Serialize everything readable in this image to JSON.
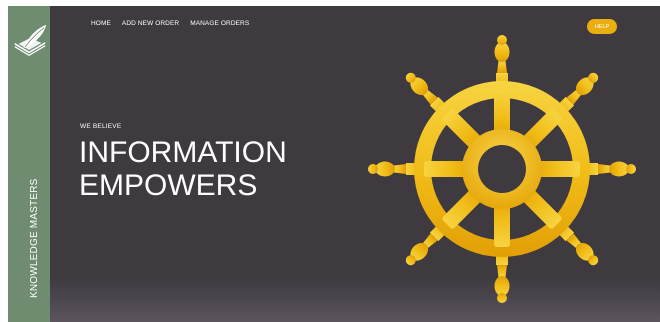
{
  "sidebar": {
    "brand": "KNOWLEDGE MASTERS",
    "logo_icon": "book-quill-icon"
  },
  "nav": {
    "items": [
      "HOME",
      "ADD NEW ORDER",
      "MANAGE ORDERS"
    ]
  },
  "help_label": "HELP",
  "hero": {
    "tagline": "WE BELIEVE",
    "headline_line1": "INFORMATION",
    "headline_line2": "EMPOWERS",
    "graphic_icon": "ship-wheel-icon"
  },
  "colors": {
    "sidebar": "#6f8c71",
    "background": "#3e3a40",
    "accent": "#e9ae0f",
    "text": "#ffffff"
  }
}
